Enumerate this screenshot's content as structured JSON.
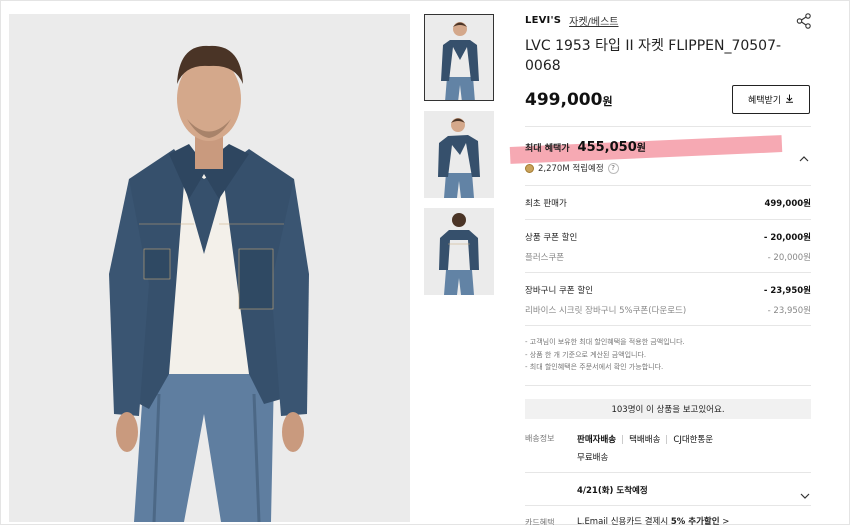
{
  "product": {
    "brand": "LEVI'S",
    "category": "자켓/베스트",
    "title": "LVC 1953 타입 II 자켓 FLIPPEN_70507-0068",
    "price": "499,000",
    "price_unit": "원",
    "benefit_button": "혜택받기"
  },
  "max_benefit": {
    "label": "최대 혜택가",
    "price": "455,050",
    "unit": "원",
    "points": "2,270M 적립예정",
    "help": "?"
  },
  "breakdown": {
    "original": {
      "label": "최초 판매가",
      "value": "499,000원"
    },
    "coupon": {
      "label": "상품 쿠폰 할인",
      "value": "- 20,000원"
    },
    "coupon_sub": {
      "label": "플러스쿠폰",
      "value": "- 20,000원"
    },
    "cart": {
      "label": "장바구니 쿠폰 할인",
      "value": "- 23,950원"
    },
    "cart_sub": {
      "label": "리바이스 시크릿 장바구니 5%쿠폰(다운로드)",
      "value": "- 23,950원"
    }
  },
  "notes": [
    "- 고객님이 보유한 최대 할인혜택을 적용한 금액입니다.",
    "- 상품 한 개 기준으로 계산된 금액입니다.",
    "- 최대 할인혜택은 주문서에서 확인 가능합니다."
  ],
  "viewers": "103명이 이 상품을 보고있어요.",
  "shipping": {
    "label": "배송정보",
    "seller": "판매자배송",
    "type": "택배배송",
    "carrier": "CJ대한통운",
    "fee": "무료배송",
    "arrival": "4/21(화) 도착예정"
  },
  "card": {
    "label": "카드혜택",
    "text_prefix": "L.Email 신용카드 결제시",
    "text_bold": "5% 추가할인",
    "arrow": ">"
  },
  "icons": {
    "share": "share-icon",
    "download": "download-icon",
    "chevron_up": "chevron-up-icon",
    "chevron_down": "chevron-down-icon",
    "points": "coin-icon"
  },
  "colors": {
    "highlight": "#f59aa6",
    "denim": "#36506c",
    "background_gray": "#ededed"
  }
}
